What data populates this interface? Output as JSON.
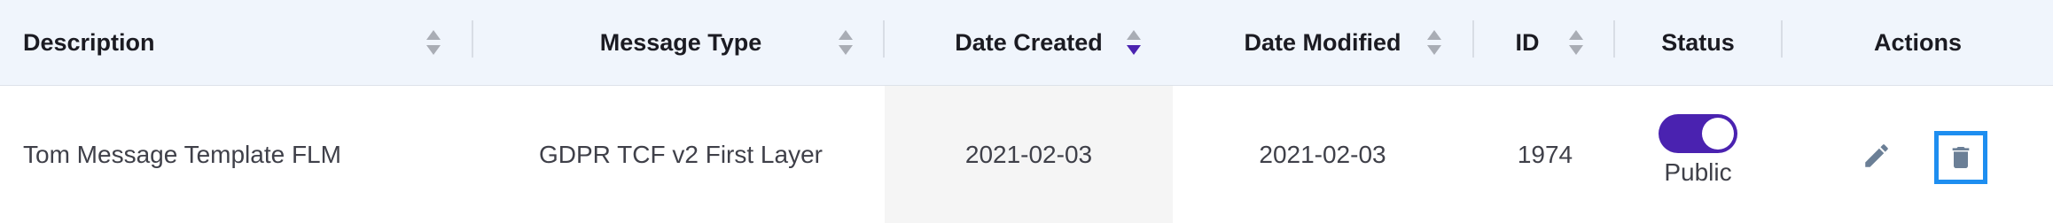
{
  "header": {
    "columns": [
      {
        "label": "Description",
        "sortable": true,
        "sort": "none"
      },
      {
        "label": "Message Type",
        "sortable": true,
        "sort": "none"
      },
      {
        "label": "Date Created",
        "sortable": true,
        "sort": "descending"
      },
      {
        "label": "Date Modified",
        "sortable": true,
        "sort": "none"
      },
      {
        "label": "ID",
        "sortable": true,
        "sort": "none"
      },
      {
        "label": "Status",
        "sortable": false
      },
      {
        "label": "Actions",
        "sortable": false
      }
    ]
  },
  "rows": [
    {
      "description": "Tom Message Template FLM",
      "message_type": "GDPR TCF v2 First Layer",
      "date_created": "2021-02-03",
      "date_modified": "2021-02-03",
      "id": "1974",
      "status": {
        "toggle_on": true,
        "label": "Public"
      },
      "actions": [
        {
          "icon": "pencil-icon",
          "action": "edit"
        },
        {
          "icon": "trash-icon",
          "action": "delete",
          "focused": true
        }
      ]
    }
  ],
  "colors": {
    "header_bg": "#f0f5fc",
    "accent": "#4a22b0",
    "sort_inactive": "#a9adb5",
    "focus_ring": "#1e8ef0",
    "icon": "#6b7f96",
    "sorted_column_bg": "#f5f5f5"
  }
}
